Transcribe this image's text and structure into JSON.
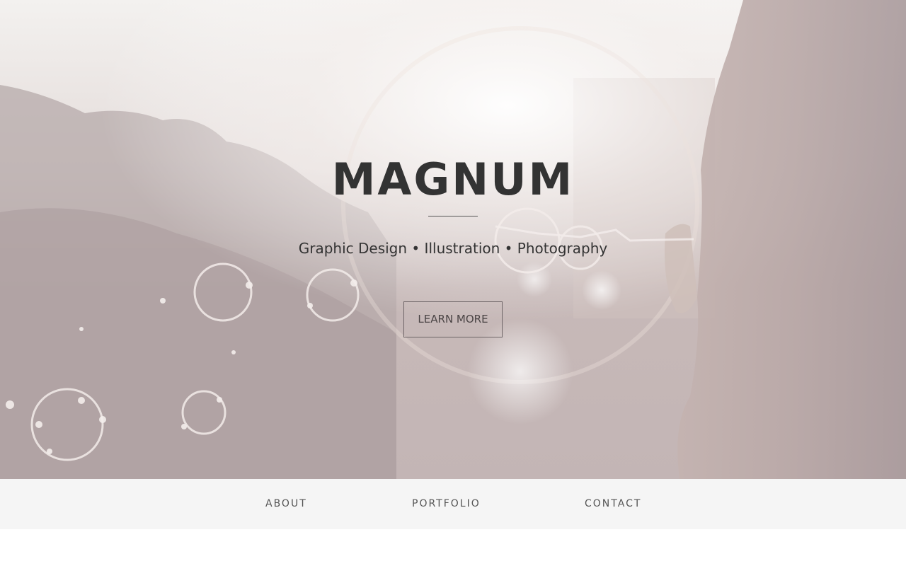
{
  "hero": {
    "title": "MAGNUM",
    "tagline": "Graphic Design • Illustration • Photography",
    "button_label": "LEARN MORE",
    "background_tint": "#c9bcbb"
  },
  "nav": {
    "items": [
      {
        "label": "ABOUT"
      },
      {
        "label": "PORTFOLIO"
      },
      {
        "label": "CONTACT"
      }
    ]
  }
}
